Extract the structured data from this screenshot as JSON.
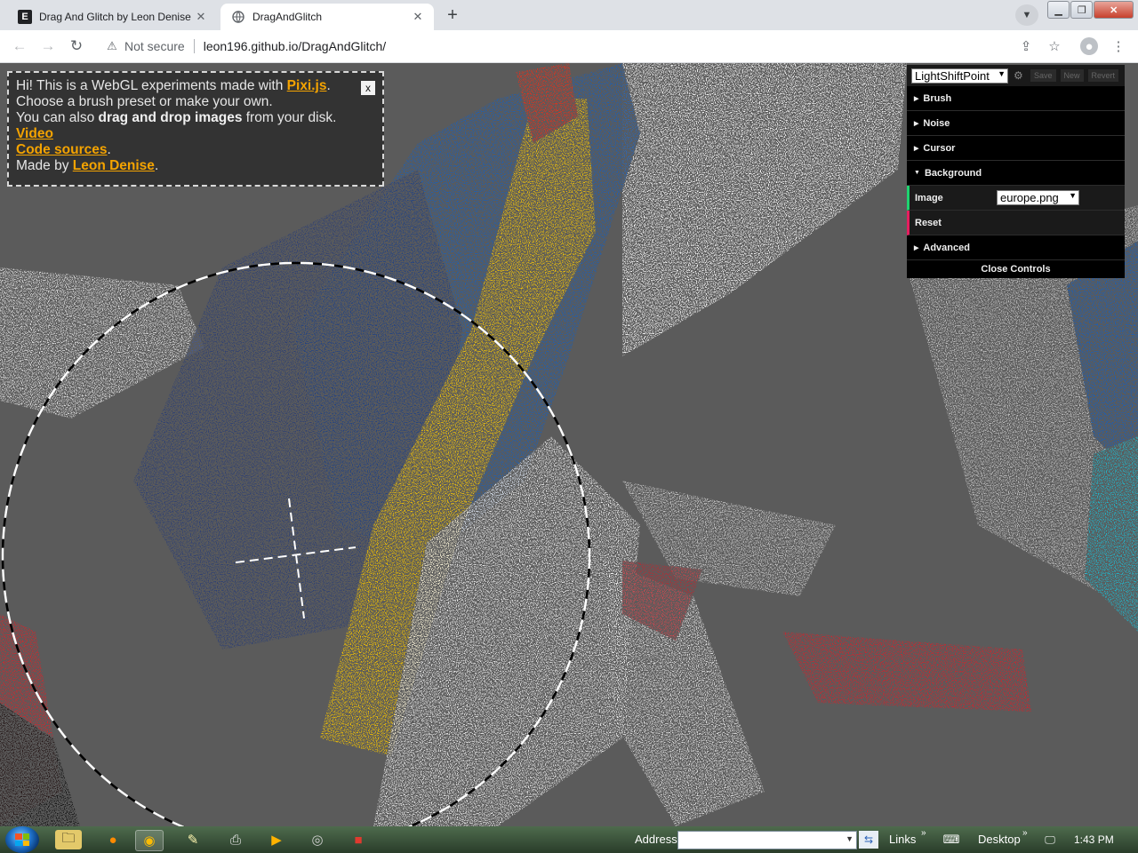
{
  "browser": {
    "tabs": [
      {
        "title": "Drag And Glitch by Leon Denise",
        "favicon": "E",
        "active": false
      },
      {
        "title": "DragAndGlitch",
        "favicon": "globe-icon",
        "active": true
      }
    ],
    "new_tab": "+",
    "security_label": "Not secure",
    "url": "leon196.github.io/DragAndGlitch/"
  },
  "info": {
    "line1_prefix": "Hi! This is a WebGL experiments made with ",
    "pixi_link": "Pixi.js",
    "line1_suffix": ".",
    "line2": "Choose a brush preset or make your own.",
    "line3_prefix": "You can also ",
    "line3_bold": "drag and drop images",
    "line3_suffix": " from your disk.",
    "video_link": "Video",
    "code_link": "Code sources",
    "code_suffix": ".",
    "made_by_prefix": "Made by ",
    "author_link": "Leon Denise",
    "made_by_suffix": ".",
    "close": "x"
  },
  "gui": {
    "preset_value": "LightShiftPoint",
    "buttons": {
      "save": "Save",
      "new": "New",
      "revert": "Revert"
    },
    "folders": {
      "brush": "Brush",
      "noise": "Noise",
      "cursor": "Cursor",
      "background": "Background",
      "advanced": "Advanced"
    },
    "image_label": "Image",
    "image_value": "europe.png",
    "reset_label": "Reset",
    "close_controls": "Close Controls",
    "colors": {
      "image_accent": "#1ed36f",
      "reset_accent": "#e61d5f"
    }
  },
  "taskbar": {
    "address_label": "Address",
    "links_label": "Links",
    "desktop_label": "Desktop",
    "clock": "1:43 PM"
  },
  "colors": {
    "canvas_bg": "#5b5b5b",
    "link": "#f4a300",
    "glitch_blue": "#1e5fb4",
    "glitch_yellow": "#f5c400",
    "glitch_red": "#d8222a"
  }
}
